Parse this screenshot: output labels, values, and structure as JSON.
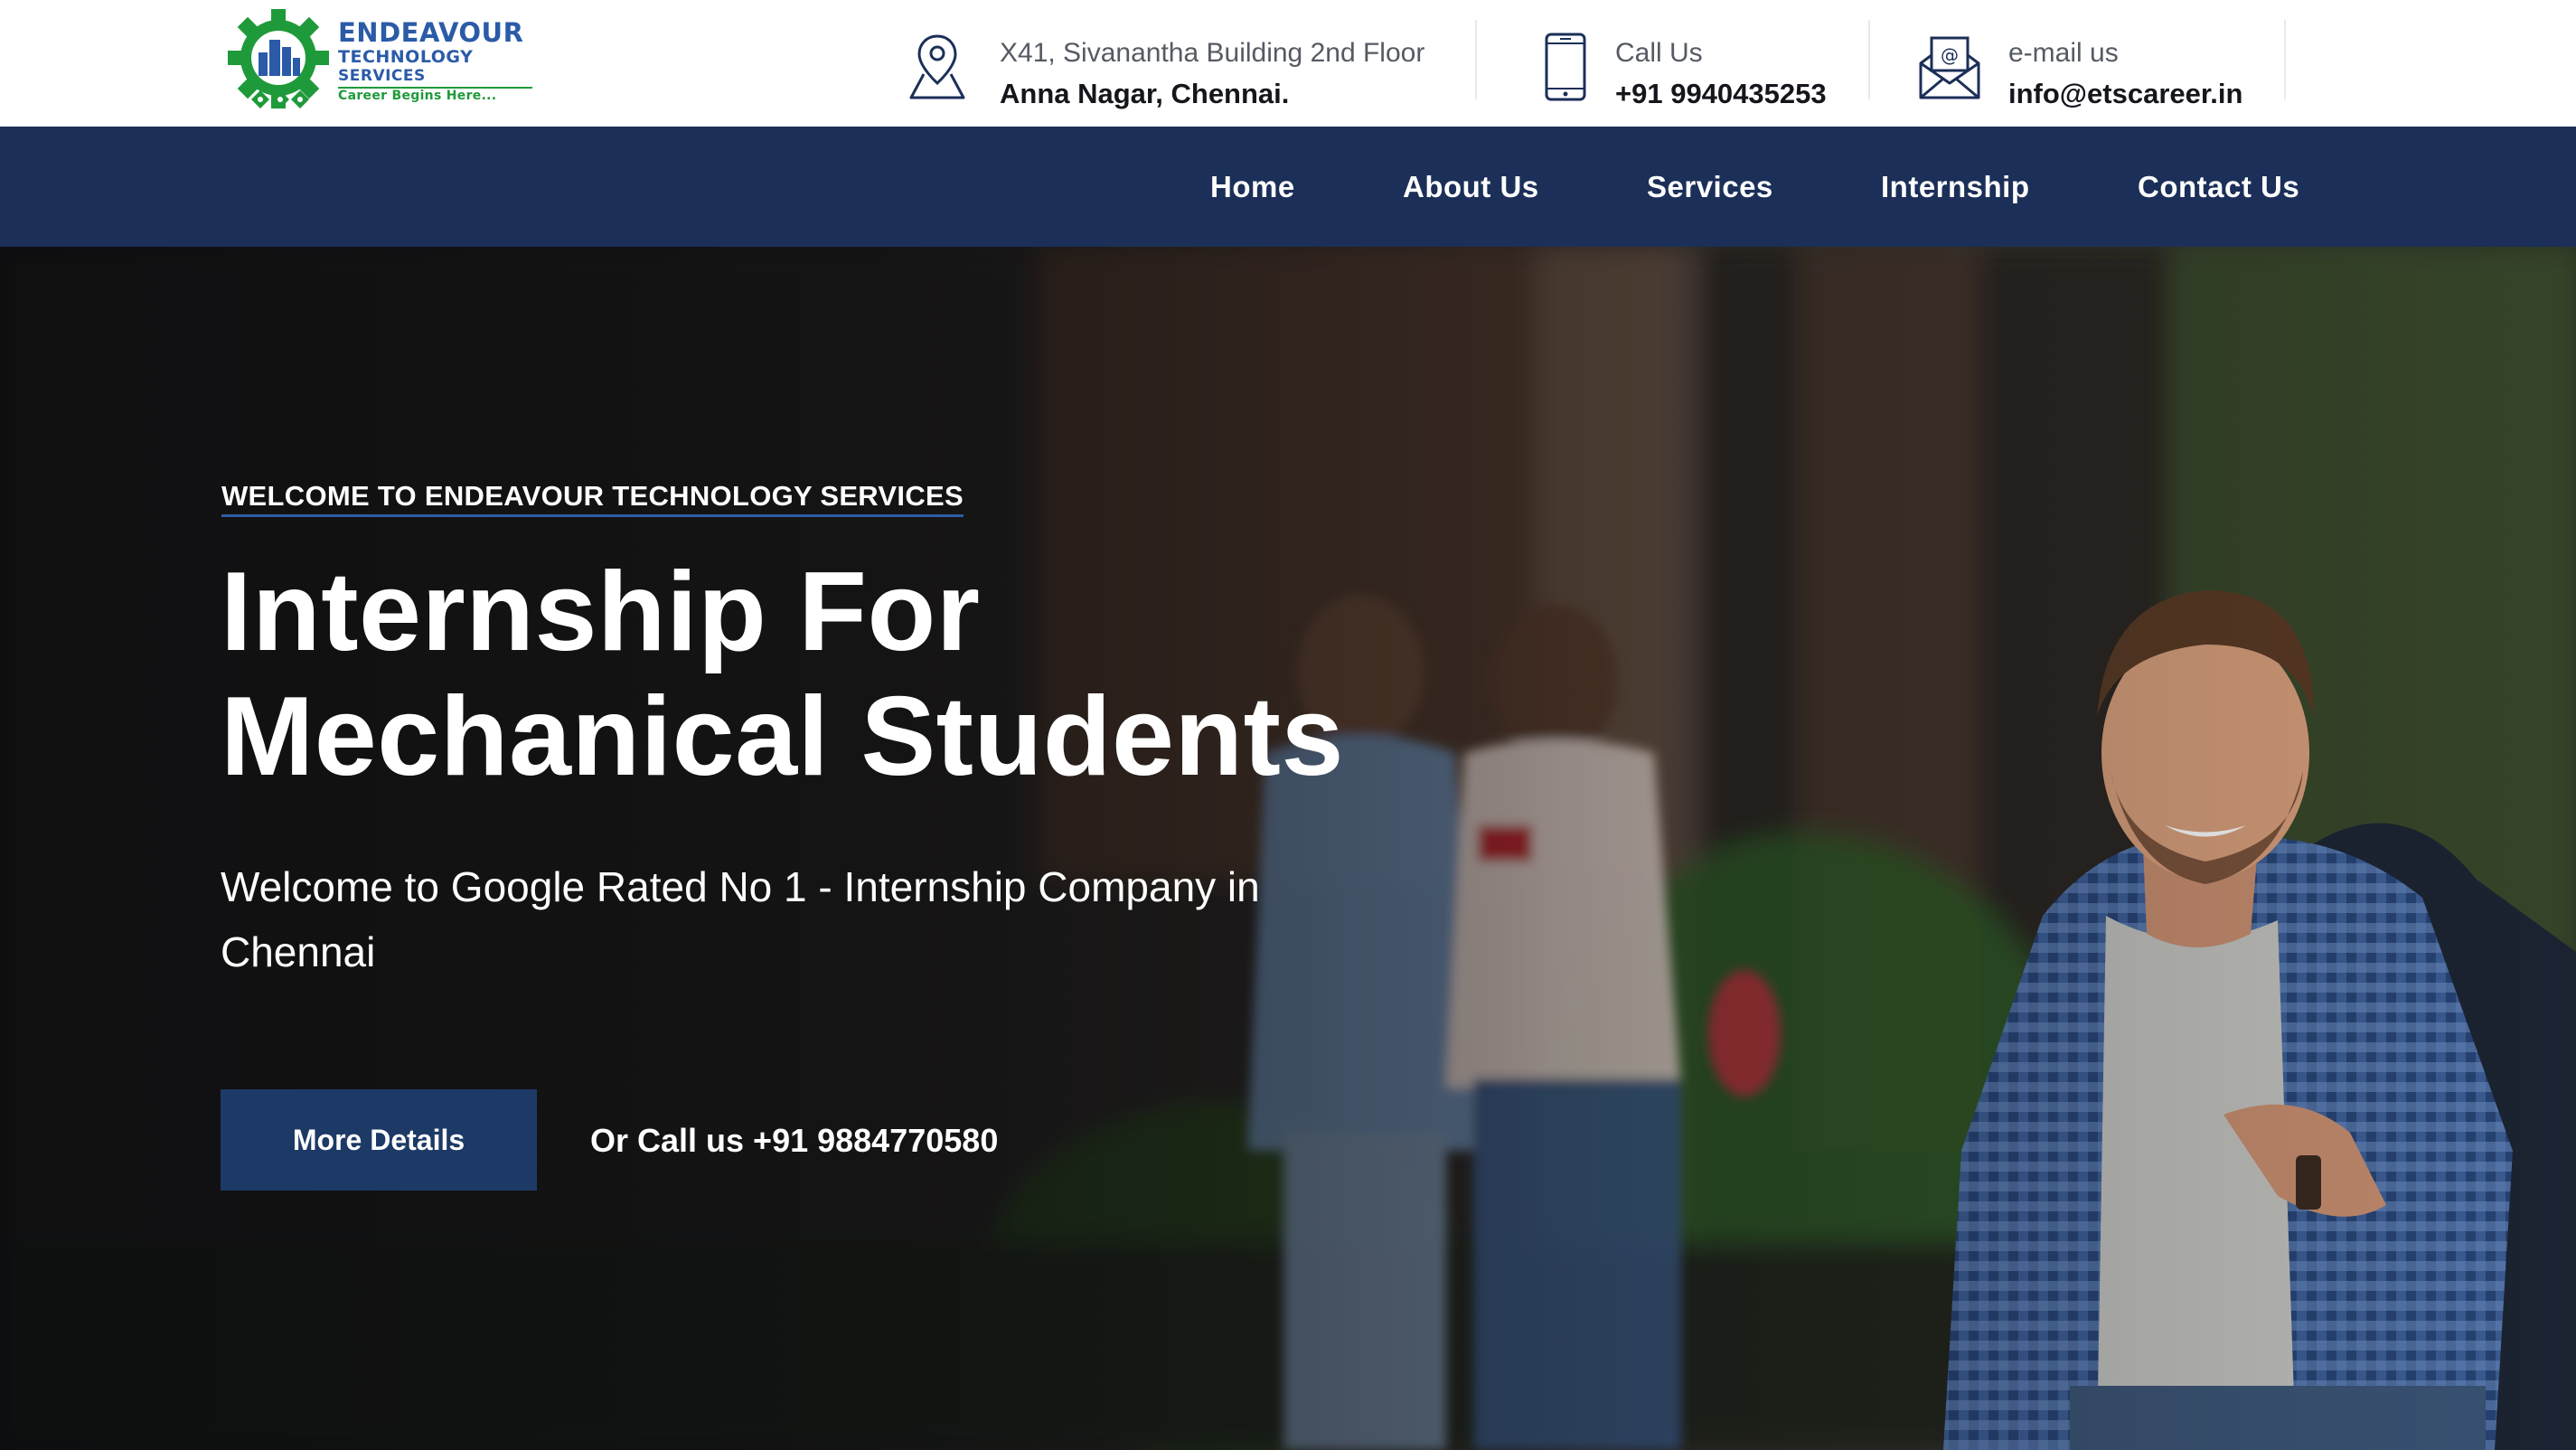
{
  "logo": {
    "line1": "ENDEAVOUR",
    "line2": "TECHNOLOGY",
    "line3": "SERVICES",
    "tagline": "Career Begins Here...",
    "colors": {
      "blue": "#2b5ba8",
      "green": "#1f9a3a"
    }
  },
  "contact": {
    "address": {
      "icon": "location-pin-icon",
      "label": "X41, Sivanantha Building 2nd Floor",
      "value": "Anna Nagar, Chennai."
    },
    "phone": {
      "icon": "mobile-phone-icon",
      "label": "Call Us",
      "value": "+91 9940435253"
    },
    "email": {
      "icon": "envelope-icon",
      "label": "e-mail us",
      "value": "info@etscareer.in"
    }
  },
  "nav": {
    "items": [
      {
        "label": "Home"
      },
      {
        "label": "About Us"
      },
      {
        "label": "Services"
      },
      {
        "label": "Internship"
      },
      {
        "label": "Contact Us"
      }
    ]
  },
  "hero": {
    "eyebrow": "WELCOME TO ENDEAVOUR TECHNOLOGY SERVICES",
    "title_line1": "Internship For",
    "title_line2": "Mechanical Students",
    "subtitle": "Welcome to Google Rated No 1 - Internship Company in Chennai",
    "cta_label": "More Details",
    "call_text": "Or Call us +91 9884770580"
  },
  "colors": {
    "nav_bg": "#1b2f58",
    "cta_bg": "#1d3a66",
    "eyebrow_underline": "#2f5da6"
  }
}
